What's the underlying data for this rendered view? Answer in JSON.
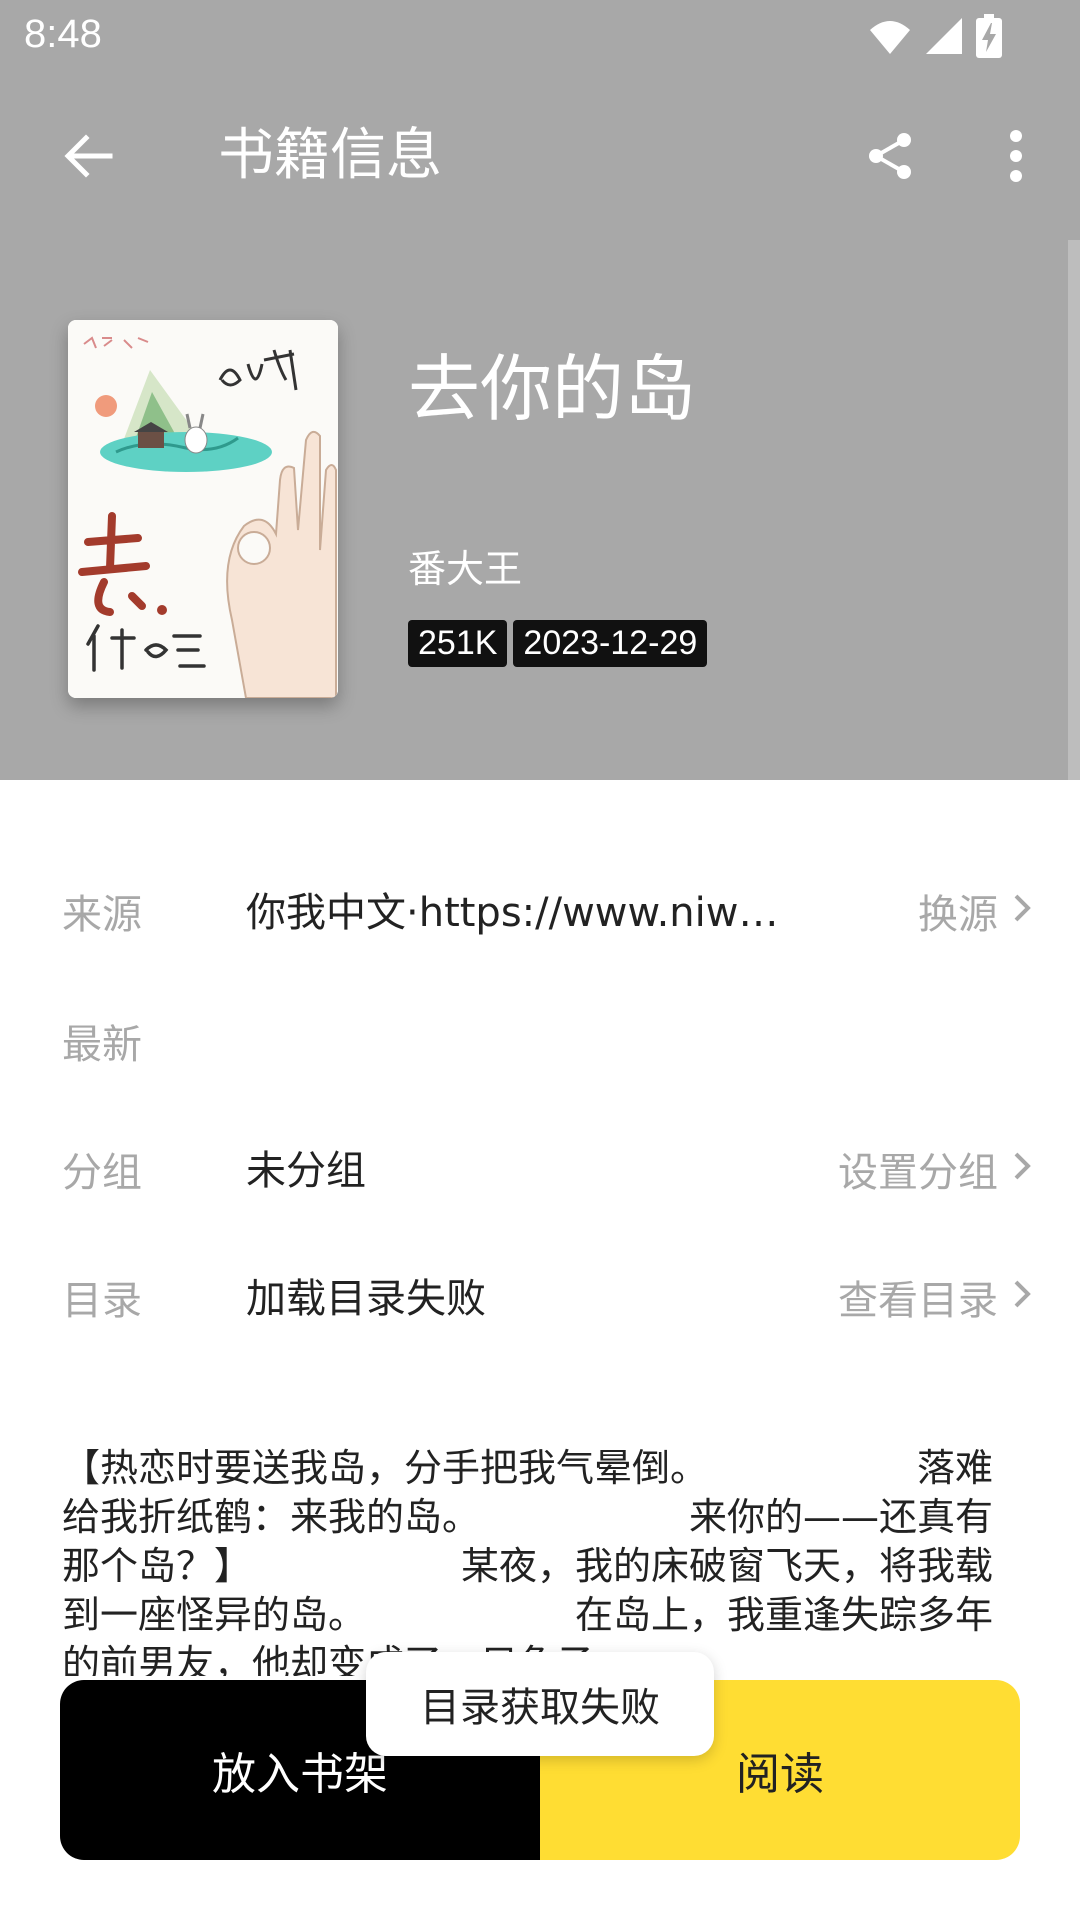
{
  "status_bar": {
    "time": "8:48",
    "icons": [
      "wifi-icon",
      "signal-icon",
      "battery-charging-icon"
    ]
  },
  "toolbar": {
    "title": "书籍信息",
    "icons": [
      "back-arrow-icon",
      "share-icon",
      "more-vert-icon"
    ]
  },
  "book": {
    "title": "去你的岛",
    "author": "番大王",
    "size": "251K",
    "date": "2023-12-29"
  },
  "rows": {
    "source": {
      "label": "来源",
      "value": "你我中文·https://www.niwo…",
      "action": "换源"
    },
    "latest": {
      "label": "最新",
      "value": ""
    },
    "group": {
      "label": "分组",
      "value": "未分组",
      "action": "设置分组"
    },
    "toc": {
      "label": "目录",
      "value": "加载目录失败",
      "action": "查看目录"
    }
  },
  "description": "【热恋时要送我岛，分手把我气晕倒。　　　　　　落难给我折纸鹤：来我的岛。　　　　　　来你的——还真有那个岛？】　　　　　　某夜，我的床破窗飞天，将我载到一座怪异的岛。　　　　　　在岛上，我重逢失踪多年的前男友，他却变成了一只兔子。",
  "buttons": {
    "add_to_shelf": "放入书架",
    "read": "阅读"
  },
  "toast": "目录获取失败",
  "colors": {
    "header_bg": "#a8a8a8",
    "read_button": "#ffdd33",
    "shelf_button": "#000000"
  }
}
